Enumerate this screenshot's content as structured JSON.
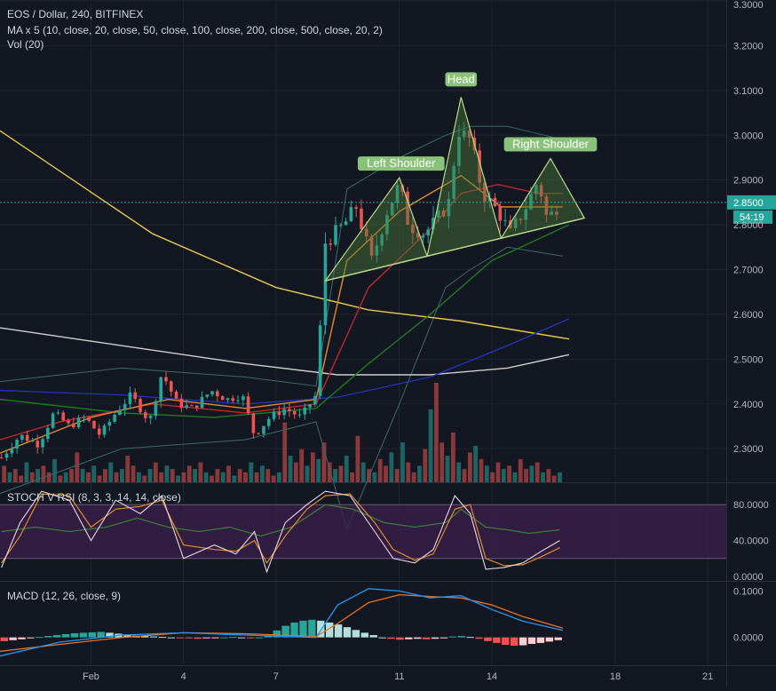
{
  "header": {
    "symbol_line": "EOS / Dollar, 240, BITFINEX",
    "ma_line": "MA x 5 (10, close, 20, close, 50, close, 100, close, 200, close, 500, close, 20, 2)",
    "vol_line": "Vol (20)"
  },
  "price_tag": {
    "value": "2.8500",
    "countdown": "54:19"
  },
  "colors": {
    "background": "#131722",
    "up": "#26a69a",
    "down": "#ef5350",
    "pattern_fill": "#4c7a3a",
    "pattern_line": "#b8d98a",
    "label_bg": "#8bc27a",
    "stoch_band": "#3a1f4a"
  },
  "pattern_labels": {
    "left": "Left Shoulder",
    "head": "Head",
    "right": "Right Shoulder"
  },
  "stoch": {
    "title": "STOCH V RSI (8, 3, 3, 14, 14, close)",
    "ticks": [
      "80.0000",
      "40.0000",
      "0.0000"
    ]
  },
  "macd": {
    "title": "MACD (12, 26, close, 9)",
    "ticks": [
      "0.1000",
      "0.0000"
    ]
  },
  "chart_data": {
    "type": "candlestick",
    "x_ticks": [
      {
        "label": "Feb",
        "day": 1
      },
      {
        "label": "4",
        "day": 4
      },
      {
        "label": "7",
        "day": 7
      },
      {
        "label": "11",
        "day": 11
      },
      {
        "label": "14",
        "day": 14
      },
      {
        "label": "18",
        "day": 18
      },
      {
        "label": "21",
        "day": 21
      }
    ],
    "x_range_days": [
      -1.95,
      21.6
    ],
    "price_axis": {
      "ticks": [
        "3.3000",
        "3.2000",
        "3.1000",
        "3.0000",
        "2.9000",
        "2.8000",
        "2.7000",
        "2.6000",
        "2.5000",
        "2.4000",
        "2.3000"
      ],
      "range": [
        2.225,
        3.302
      ]
    },
    "price_path": [
      {
        "day": -1.9,
        "price": 2.28
      },
      {
        "day": -1.3,
        "price": 2.33
      },
      {
        "day": -0.7,
        "price": 2.31
      },
      {
        "day": -0.2,
        "price": 2.38
      },
      {
        "day": 0.3,
        "price": 2.35
      },
      {
        "day": 0.8,
        "price": 2.37
      },
      {
        "day": 1.3,
        "price": 2.33
      },
      {
        "day": 1.8,
        "price": 2.38
      },
      {
        "day": 2.3,
        "price": 2.42
      },
      {
        "day": 2.9,
        "price": 2.36
      },
      {
        "day": 3.3,
        "price": 2.47
      },
      {
        "day": 3.8,
        "price": 2.4
      },
      {
        "day": 4.3,
        "price": 2.39
      },
      {
        "day": 4.9,
        "price": 2.43
      },
      {
        "day": 5.4,
        "price": 2.41
      },
      {
        "day": 5.9,
        "price": 2.42
      },
      {
        "day": 6.3,
        "price": 2.33
      },
      {
        "day": 6.8,
        "price": 2.37
      },
      {
        "day": 7.3,
        "price": 2.39
      },
      {
        "day": 7.8,
        "price": 2.37
      },
      {
        "day": 8.3,
        "price": 2.42
      },
      {
        "day": 8.6,
        "price": 2.76
      },
      {
        "day": 9.2,
        "price": 2.8
      },
      {
        "day": 9.6,
        "price": 2.84
      },
      {
        "day": 10.1,
        "price": 2.72
      },
      {
        "day": 10.6,
        "price": 2.83
      },
      {
        "day": 11.0,
        "price": 2.89
      },
      {
        "day": 11.3,
        "price": 2.8
      },
      {
        "day": 11.8,
        "price": 2.78
      },
      {
        "day": 12.2,
        "price": 2.81
      },
      {
        "day": 12.6,
        "price": 2.85
      },
      {
        "day": 12.9,
        "price": 3.01
      },
      {
        "day": 13.3,
        "price": 2.99
      },
      {
        "day": 13.7,
        "price": 2.87
      },
      {
        "day": 14.2,
        "price": 2.83
      },
      {
        "day": 14.6,
        "price": 2.78
      },
      {
        "day": 15.1,
        "price": 2.84
      },
      {
        "day": 15.5,
        "price": 2.9
      },
      {
        "day": 15.8,
        "price": 2.81
      },
      {
        "day": 16.2,
        "price": 2.85
      }
    ],
    "volume_bars": [
      5,
      3,
      4,
      2,
      6,
      3,
      4,
      5,
      3,
      7,
      2,
      3,
      4,
      9,
      4,
      3,
      5,
      2,
      4,
      6,
      3,
      4,
      8,
      5,
      3,
      2,
      4,
      6,
      3,
      5,
      4,
      2,
      3,
      5,
      4,
      6,
      3,
      2,
      4,
      3,
      5,
      2,
      4,
      3,
      6,
      3,
      5,
      4,
      2,
      3,
      18,
      8,
      6,
      10,
      5,
      9,
      7,
      12,
      6,
      4,
      5,
      8,
      3,
      14,
      6,
      4,
      3,
      7,
      5,
      9,
      4,
      12,
      6,
      3,
      5,
      10,
      22,
      30,
      12,
      8,
      15,
      6,
      4,
      9,
      11,
      7,
      5,
      3,
      6,
      4,
      5,
      3,
      7,
      4,
      5,
      6,
      3,
      4,
      2,
      3
    ],
    "pattern": {
      "name": "Head and Shoulders",
      "left_shoulder": {
        "day": 11.0,
        "price": 2.905
      },
      "head": {
        "day": 13.0,
        "price": 3.085
      },
      "right_shoulder": {
        "day": 15.9,
        "price": 2.948
      },
      "neckline_start": {
        "day": 8.6,
        "price": 2.675
      },
      "neckline_end": {
        "day": 17.0,
        "price": 2.815
      }
    },
    "moving_averages": [
      {
        "color": "#e6c84a",
        "points": [
          {
            "day": -1.95,
            "price": 3.01
          },
          {
            "day": 3,
            "price": 2.78
          },
          {
            "day": 7,
            "price": 2.66
          },
          {
            "day": 10,
            "price": 2.61
          },
          {
            "day": 13,
            "price": 2.585
          },
          {
            "day": 16.5,
            "price": 2.545
          }
        ]
      },
      {
        "color": "#cfcfcf",
        "points": [
          {
            "day": -1.95,
            "price": 2.57
          },
          {
            "day": 2,
            "price": 2.53
          },
          {
            "day": 6,
            "price": 2.49
          },
          {
            "day": 9,
            "price": 2.465
          },
          {
            "day": 12,
            "price": 2.465
          },
          {
            "day": 14.5,
            "price": 2.48
          },
          {
            "day": 16.5,
            "price": 2.51
          }
        ]
      },
      {
        "color": "#2233b8",
        "points": [
          {
            "day": -1.95,
            "price": 2.43
          },
          {
            "day": 2,
            "price": 2.42
          },
          {
            "day": 6,
            "price": 2.4
          },
          {
            "day": 9,
            "price": 2.415
          },
          {
            "day": 12,
            "price": 2.46
          },
          {
            "day": 14.5,
            "price": 2.53
          },
          {
            "day": 16.5,
            "price": 2.59
          }
        ]
      },
      {
        "color": "#1f7a22",
        "points": [
          {
            "day": -1.95,
            "price": 2.41
          },
          {
            "day": 2,
            "price": 2.38
          },
          {
            "day": 5,
            "price": 2.37
          },
          {
            "day": 8.3,
            "price": 2.39
          },
          {
            "day": 10,
            "price": 2.49
          },
          {
            "day": 12,
            "price": 2.6
          },
          {
            "day": 14,
            "price": 2.72
          },
          {
            "day": 16.5,
            "price": 2.8
          }
        ]
      },
      {
        "color": "#c0262c",
        "points": [
          {
            "day": -1.95,
            "price": 2.32
          },
          {
            "day": 0,
            "price": 2.36
          },
          {
            "day": 3,
            "price": 2.4
          },
          {
            "day": 6,
            "price": 2.38
          },
          {
            "day": 8.3,
            "price": 2.4
          },
          {
            "day": 10,
            "price": 2.66
          },
          {
            "day": 12,
            "price": 2.79
          },
          {
            "day": 13,
            "price": 2.87
          },
          {
            "day": 14.2,
            "price": 2.89
          },
          {
            "day": 15.5,
            "price": 2.87
          },
          {
            "day": 16.3,
            "price": 2.87
          }
        ]
      },
      {
        "color": "#e08b2c",
        "points": [
          {
            "day": -1.95,
            "price": 2.29
          },
          {
            "day": 1,
            "price": 2.37
          },
          {
            "day": 3.5,
            "price": 2.41
          },
          {
            "day": 6,
            "price": 2.39
          },
          {
            "day": 8.3,
            "price": 2.41
          },
          {
            "day": 9.3,
            "price": 2.72
          },
          {
            "day": 11,
            "price": 2.83
          },
          {
            "day": 13,
            "price": 2.91
          },
          {
            "day": 14.3,
            "price": 2.84
          },
          {
            "day": 16.3,
            "price": 2.84
          }
        ]
      }
    ],
    "stoch_axis": {
      "range": [
        -2,
        102
      ]
    },
    "stoch_k": [
      {
        "day": -1.9,
        "value": 10
      },
      {
        "day": -1.3,
        "value": 60
      },
      {
        "day": -0.6,
        "value": 95
      },
      {
        "day": 0.3,
        "value": 85
      },
      {
        "day": 1.0,
        "value": 40
      },
      {
        "day": 1.8,
        "value": 85
      },
      {
        "day": 2.6,
        "value": 70
      },
      {
        "day": 3.3,
        "value": 90
      },
      {
        "day": 4.0,
        "value": 20
      },
      {
        "day": 5.0,
        "value": 35
      },
      {
        "day": 5.7,
        "value": 25
      },
      {
        "day": 6.3,
        "value": 50
      },
      {
        "day": 6.7,
        "value": 5
      },
      {
        "day": 7.3,
        "value": 60
      },
      {
        "day": 8.0,
        "value": 80
      },
      {
        "day": 8.6,
        "value": 95
      },
      {
        "day": 9.4,
        "value": 90
      },
      {
        "day": 10.2,
        "value": 50
      },
      {
        "day": 10.8,
        "value": 20
      },
      {
        "day": 11.5,
        "value": 15
      },
      {
        "day": 12.1,
        "value": 30
      },
      {
        "day": 12.8,
        "value": 90
      },
      {
        "day": 13.3,
        "value": 70
      },
      {
        "day": 13.8,
        "value": 8
      },
      {
        "day": 14.4,
        "value": 10
      },
      {
        "day": 15.0,
        "value": 15
      },
      {
        "day": 15.6,
        "value": 28
      },
      {
        "day": 16.2,
        "value": 40
      }
    ],
    "stoch_d": [
      {
        "day": -1.9,
        "value": 15
      },
      {
        "day": -1.3,
        "value": 45
      },
      {
        "day": -0.6,
        "value": 92
      },
      {
        "day": 0.3,
        "value": 90
      },
      {
        "day": 1.0,
        "value": 55
      },
      {
        "day": 1.8,
        "value": 75
      },
      {
        "day": 2.6,
        "value": 78
      },
      {
        "day": 3.3,
        "value": 85
      },
      {
        "day": 4.0,
        "value": 35
      },
      {
        "day": 5.0,
        "value": 30
      },
      {
        "day": 5.7,
        "value": 28
      },
      {
        "day": 6.3,
        "value": 40
      },
      {
        "day": 6.7,
        "value": 15
      },
      {
        "day": 7.3,
        "value": 45
      },
      {
        "day": 8.0,
        "value": 75
      },
      {
        "day": 8.6,
        "value": 90
      },
      {
        "day": 9.4,
        "value": 92
      },
      {
        "day": 10.2,
        "value": 60
      },
      {
        "day": 10.8,
        "value": 30
      },
      {
        "day": 11.5,
        "value": 18
      },
      {
        "day": 12.1,
        "value": 25
      },
      {
        "day": 12.8,
        "value": 75
      },
      {
        "day": 13.3,
        "value": 80
      },
      {
        "day": 13.8,
        "value": 20
      },
      {
        "day": 14.4,
        "value": 12
      },
      {
        "day": 15.0,
        "value": 13
      },
      {
        "day": 15.6,
        "value": 22
      },
      {
        "day": 16.2,
        "value": 32
      }
    ],
    "stoch_rsi": [
      {
        "day": -1.9,
        "value": 50
      },
      {
        "day": -0.8,
        "value": 55
      },
      {
        "day": 0.3,
        "value": 50
      },
      {
        "day": 1.5,
        "value": 55
      },
      {
        "day": 2.5,
        "value": 65
      },
      {
        "day": 3.5,
        "value": 55
      },
      {
        "day": 4.5,
        "value": 50
      },
      {
        "day": 5.5,
        "value": 55
      },
      {
        "day": 6.5,
        "value": 45
      },
      {
        "day": 7.5,
        "value": 55
      },
      {
        "day": 8.6,
        "value": 80
      },
      {
        "day": 9.5,
        "value": 75
      },
      {
        "day": 10.5,
        "value": 60
      },
      {
        "day": 11.5,
        "value": 55
      },
      {
        "day": 12.5,
        "value": 60
      },
      {
        "day": 13.0,
        "value": 75
      },
      {
        "day": 13.8,
        "value": 55
      },
      {
        "day": 14.5,
        "value": 52
      },
      {
        "day": 15.2,
        "value": 48
      },
      {
        "day": 16.2,
        "value": 52
      }
    ],
    "macd_axis": {
      "range": [
        -0.06,
        0.118
      ]
    },
    "macd_line": [
      {
        "day": -1.95,
        "value": -0.04
      },
      {
        "day": 0,
        "value": -0.01
      },
      {
        "day": 2,
        "value": 0.005
      },
      {
        "day": 4,
        "value": 0.01
      },
      {
        "day": 6,
        "value": 0.005
      },
      {
        "day": 8.3,
        "value": 0.0
      },
      {
        "day": 9.0,
        "value": 0.07
      },
      {
        "day": 10.0,
        "value": 0.105
      },
      {
        "day": 11.0,
        "value": 0.1
      },
      {
        "day": 12.0,
        "value": 0.085
      },
      {
        "day": 13.0,
        "value": 0.09
      },
      {
        "day": 14.0,
        "value": 0.06
      },
      {
        "day": 15.0,
        "value": 0.035
      },
      {
        "day": 16.3,
        "value": 0.015
      }
    ],
    "macd_signal": [
      {
        "day": -1.95,
        "value": -0.03
      },
      {
        "day": 0,
        "value": -0.015
      },
      {
        "day": 2,
        "value": 0.0
      },
      {
        "day": 4,
        "value": 0.01
      },
      {
        "day": 6,
        "value": 0.008
      },
      {
        "day": 8.3,
        "value": 0.002
      },
      {
        "day": 9.0,
        "value": 0.03
      },
      {
        "day": 10.0,
        "value": 0.075
      },
      {
        "day": 11.0,
        "value": 0.092
      },
      {
        "day": 12.0,
        "value": 0.088
      },
      {
        "day": 13.0,
        "value": 0.085
      },
      {
        "day": 14.0,
        "value": 0.07
      },
      {
        "day": 15.0,
        "value": 0.045
      },
      {
        "day": 16.3,
        "value": 0.02
      }
    ],
    "macd_hist": [
      -0.008,
      -0.006,
      -0.004,
      -0.002,
      0.001,
      0.003,
      0.005,
      0.007,
      0.009,
      0.01,
      0.011,
      0.012,
      0.01,
      0.008,
      0.006,
      0.004,
      0.003,
      0.002,
      0.001,
      0.0,
      -0.001,
      -0.002,
      -0.003,
      -0.002,
      -0.001,
      0.0,
      0.001,
      0.0,
      -0.001,
      0.0,
      0.005,
      0.015,
      0.025,
      0.032,
      0.036,
      0.038,
      0.036,
      0.032,
      0.028,
      0.022,
      0.016,
      0.01,
      0.005,
      0.0,
      -0.003,
      -0.005,
      -0.004,
      -0.003,
      -0.004,
      -0.003,
      -0.002,
      0.002,
      0.003,
      0.001,
      -0.003,
      -0.008,
      -0.012,
      -0.016,
      -0.018,
      -0.017,
      -0.014,
      -0.012,
      -0.009,
      -0.006
    ]
  }
}
